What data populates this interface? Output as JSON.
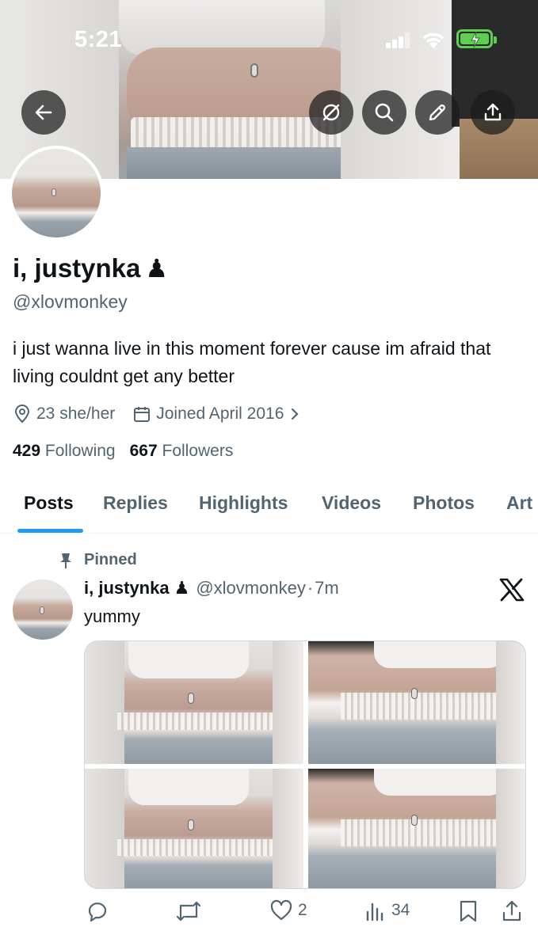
{
  "status_bar": {
    "time": "5:21"
  },
  "profile": {
    "name": "i, justynka",
    "name_emoji": "♟",
    "handle": "@xlovmonkey",
    "bio": "i just wanna live in this moment forever cause im afraid that living couldnt get any better",
    "location": "23 she/her",
    "joined": "Joined April 2016",
    "following_count": "429",
    "following_label": "Following",
    "followers_count": "667",
    "followers_label": "Followers"
  },
  "tabs": [
    {
      "label": "Posts",
      "active": true
    },
    {
      "label": "Replies",
      "active": false
    },
    {
      "label": "Highlights",
      "active": false
    },
    {
      "label": "Videos",
      "active": false
    },
    {
      "label": "Photos",
      "active": false
    },
    {
      "label": "Art",
      "active": false
    }
  ],
  "post": {
    "pinned_label": "Pinned",
    "author_name": "i, justynka",
    "author_emoji": "♟",
    "author_handle": "@xlovmonkey",
    "separator": "·",
    "time": "7m",
    "text": "yummy",
    "likes": "2",
    "views": "34"
  },
  "colors": {
    "accent": "#1d9bf0",
    "text_primary": "#0f1419",
    "text_secondary": "#536471",
    "battery": "#5fcf52"
  },
  "icons": {
    "back": "arrow-left-icon",
    "grok": "grok-icon",
    "search": "search-icon",
    "edit": "pencil-icon",
    "share": "share-icon",
    "location": "location-pin-icon",
    "calendar": "calendar-icon",
    "pin": "pin-icon",
    "brand": "x-logo-icon",
    "reply": "reply-icon",
    "repost": "repost-icon",
    "like": "heart-icon",
    "views": "views-icon",
    "bookmark": "bookmark-icon"
  }
}
